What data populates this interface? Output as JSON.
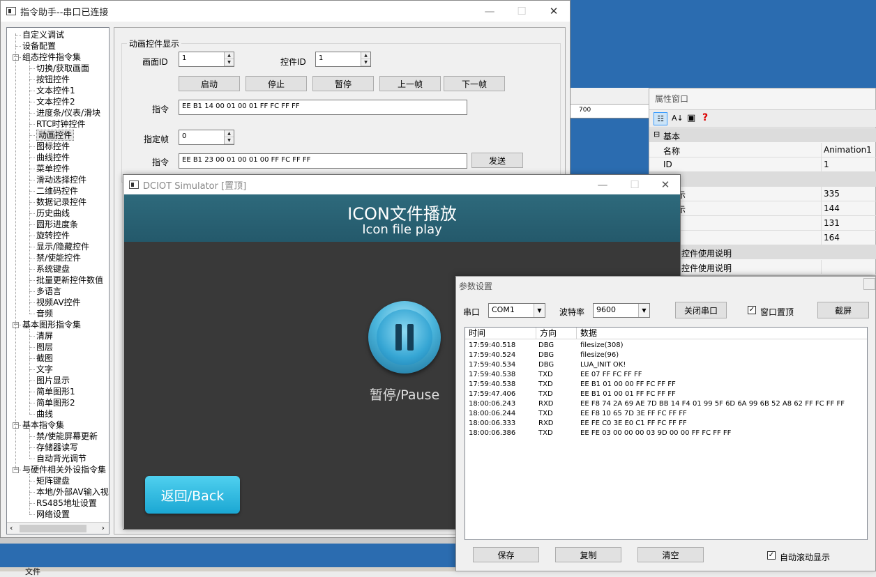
{
  "main_window": {
    "title": "指令助手--串口已连接",
    "group_title": "动画控件显示",
    "screen_id_label": "画面ID",
    "screen_id_value": "1",
    "control_id_label": "控件ID",
    "control_id_value": "1",
    "buttons": [
      "启动",
      "停止",
      "暂停",
      "上一帧",
      "下一帧"
    ],
    "cmd_label": "指令",
    "cmd1": "EE B1 14 00 01 00 01 FF FC FF FF",
    "frame_label": "指定帧",
    "frame_value": "0",
    "cmd2": "EE B1 23 00 01 00 01 00 FF FC FF FF",
    "send_label": "发送"
  },
  "tree": [
    {
      "label": "自定义调试",
      "level": 0
    },
    {
      "label": "设备配置",
      "level": 0
    },
    {
      "label": "组态控件指令集",
      "level": 0,
      "expandable": true
    },
    {
      "label": "切换/获取画面",
      "level": 1
    },
    {
      "label": "按钮控件",
      "level": 1
    },
    {
      "label": "文本控件1",
      "level": 1
    },
    {
      "label": "文本控件2",
      "level": 1
    },
    {
      "label": "进度条/仪表/滑块",
      "level": 1
    },
    {
      "label": "RTC时钟控件",
      "level": 1
    },
    {
      "label": "动画控件",
      "level": 1,
      "selected": true
    },
    {
      "label": "图标控件",
      "level": 1
    },
    {
      "label": "曲线控件",
      "level": 1
    },
    {
      "label": "菜单控件",
      "level": 1
    },
    {
      "label": "滑动选择控件",
      "level": 1
    },
    {
      "label": "二维码控件",
      "level": 1
    },
    {
      "label": "数据记录控件",
      "level": 1
    },
    {
      "label": "历史曲线",
      "level": 1
    },
    {
      "label": "圆形进度条",
      "level": 1
    },
    {
      "label": "旋转控件",
      "level": 1
    },
    {
      "label": "显示/隐藏控件",
      "level": 1
    },
    {
      "label": "禁/使能控件",
      "level": 1
    },
    {
      "label": "系统键盘",
      "level": 1
    },
    {
      "label": "批量更新控件数值",
      "level": 1
    },
    {
      "label": "多语言",
      "level": 1
    },
    {
      "label": "视频AV控件",
      "level": 1
    },
    {
      "label": "音频",
      "level": 1
    },
    {
      "label": "基本图形指令集",
      "level": 0,
      "expandable": true
    },
    {
      "label": "清屏",
      "level": 1
    },
    {
      "label": "图层",
      "level": 1
    },
    {
      "label": "截图",
      "level": 1
    },
    {
      "label": "文字",
      "level": 1
    },
    {
      "label": "图片显示",
      "level": 1
    },
    {
      "label": "简单图形1",
      "level": 1
    },
    {
      "label": "简单图形2",
      "level": 1
    },
    {
      "label": "曲线",
      "level": 1
    },
    {
      "label": "基本指令集",
      "level": 0,
      "expandable": true
    },
    {
      "label": "禁/使能屏幕更新",
      "level": 1
    },
    {
      "label": "存储器读写",
      "level": 1
    },
    {
      "label": "自动背光调节",
      "level": 1
    },
    {
      "label": "与硬件相关外设指令集",
      "level": 0,
      "expandable": true
    },
    {
      "label": "矩阵键盘",
      "level": 1
    },
    {
      "label": "本地/外部AV输入视频",
      "level": 1
    },
    {
      "label": "RS485地址设置",
      "level": 1
    },
    {
      "label": "网络设置",
      "level": 1
    }
  ],
  "simulator": {
    "title": "DCIOT Simulator [置顶]",
    "header_cn": "ICON文件播放",
    "header_en": "Icon file play",
    "pause_label": "暂停/Pause",
    "back_label": "返回/Back"
  },
  "ruler_mark": "700",
  "properties": {
    "title": "属性窗口",
    "section_basic": "基本",
    "rows": [
      {
        "key": "名称",
        "value": "Animation1"
      },
      {
        "key": "ID",
        "value": "1"
      }
    ],
    "values": [
      "335",
      "144",
      "131",
      "164"
    ],
    "fragment_1": "示",
    "fragment_2": "示",
    "section_desc": "控件使用说明",
    "desc_row": "控件使用说明"
  },
  "param": {
    "title": "参数设置",
    "port_label": "串口",
    "port_value": "COM1",
    "baud_label": "波特率",
    "baud_value": "9600",
    "close_port": "关闭串口",
    "topmost_label": "窗口置顶",
    "screenshot_label": "截屏",
    "columns": [
      "时间",
      "方向",
      "数据"
    ],
    "log": [
      {
        "time": "17:59:40.518",
        "dir": "DBG",
        "data": "filesize(308)"
      },
      {
        "time": "17:59:40.524",
        "dir": "DBG",
        "data": "filesize(96)"
      },
      {
        "time": "17:59:40.534",
        "dir": "DBG",
        "data": "LUA_INIT OK!"
      },
      {
        "time": "17:59:40.538",
        "dir": "TXD",
        "data": "EE 07 FF FC FF FF"
      },
      {
        "time": "17:59:40.538",
        "dir": "TXD",
        "data": "EE B1 01 00 00 FF FC FF FF"
      },
      {
        "time": "17:59:47.406",
        "dir": "TXD",
        "data": "EE B1 01 00 01 FF FC FF FF"
      },
      {
        "time": "18:00:06.243",
        "dir": "RXD",
        "data": "EE F8 74 2A 69 AE 7D BB 14 F4 01 99 5F 6D 6A 99 6B 52 A8 62 FF FC FF FF"
      },
      {
        "time": "18:00:06.244",
        "dir": "TXD",
        "data": "EE F8 10 65 7D 3E FF FC FF FF"
      },
      {
        "time": "18:00:06.333",
        "dir": "RXD",
        "data": "EE FE C0 3E E0 C1 FF FC FF FF"
      },
      {
        "time": "18:00:06.386",
        "dir": "TXD",
        "data": "EE FE 03 00 00 00 03 9D 00 00 FF FC FF FF"
      }
    ],
    "save_label": "保存",
    "copy_label": "复制",
    "clear_label": "清空",
    "autoscroll_label": "自动滚动显示"
  },
  "bottom_fragment": "文件"
}
